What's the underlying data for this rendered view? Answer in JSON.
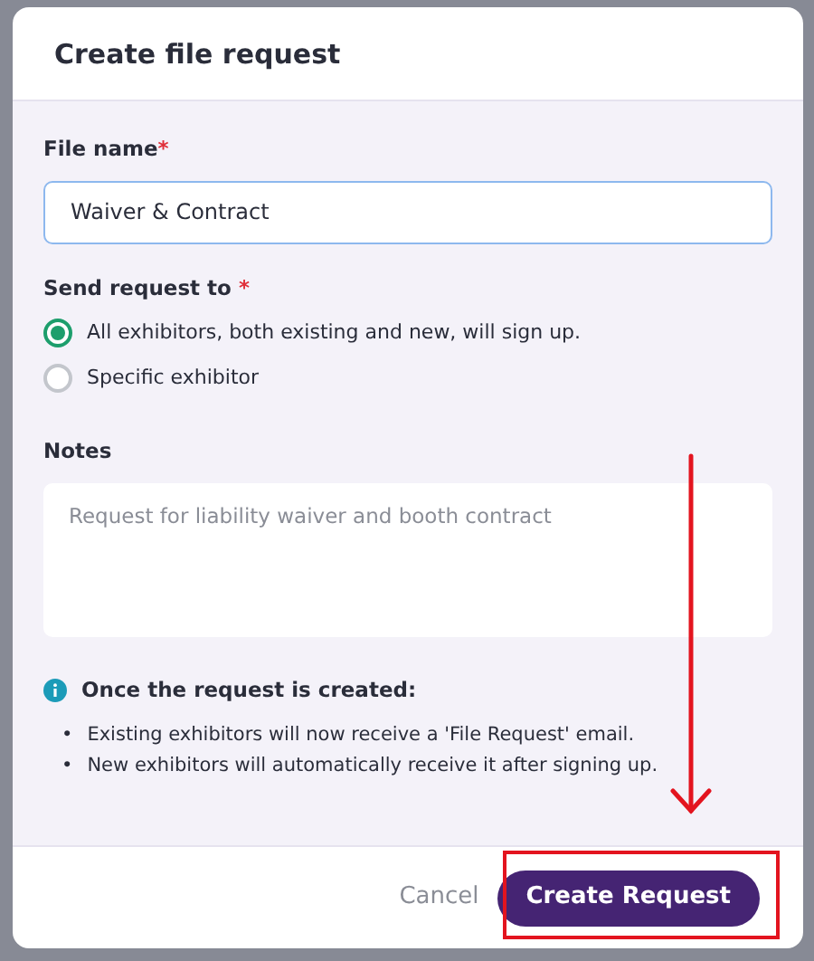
{
  "dialog": {
    "title": "Create file request"
  },
  "file_name": {
    "label": "File name",
    "required_mark": "*",
    "value": "Waiver & Contract"
  },
  "send_to": {
    "label": "Send request to",
    "required_mark": "*",
    "options": [
      {
        "label": "All exhibitors, both existing and new, will sign up.",
        "selected": true
      },
      {
        "label": "Specific exhibitor",
        "selected": false
      }
    ]
  },
  "notes": {
    "label": "Notes",
    "placeholder": "Request for liability waiver and booth contract"
  },
  "info": {
    "title": "Once the request is created:",
    "bullets": [
      {
        "marker": "•",
        "text": "Existing exhibitors will now receive a 'File Request' email."
      },
      {
        "marker": "•",
        "text": "New exhibitors will automatically receive it after signing up."
      }
    ]
  },
  "buttons": [
    {
      "label": "Cancel",
      "kind": "secondary"
    },
    {
      "label": "Create Request",
      "kind": "primary"
    }
  ]
}
